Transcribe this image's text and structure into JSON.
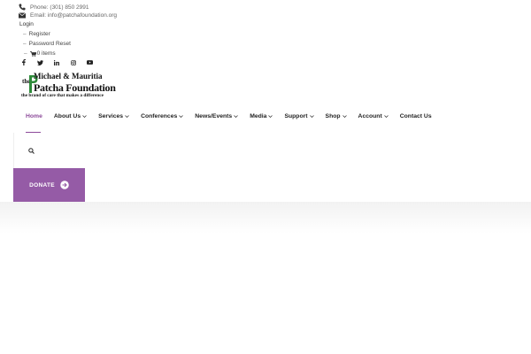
{
  "topbar": {
    "phone": "Phone: (301) 850 2991",
    "email": "Email: info@patchafoundation.org",
    "login": "Login",
    "register": "Register",
    "password_reset": "Password Reset",
    "cart": "0 items",
    "dash": "–",
    "social": [
      "facebook-icon",
      "twitter-icon",
      "linkedin-icon",
      "instagram-icon",
      "youtube-icon"
    ]
  },
  "logo": {
    "line1": "Michael & Mauritia",
    "line2": "Patcha Foundation",
    "the": "the",
    "tagline": "the brand of care that makes a difference"
  },
  "nav": {
    "items": [
      {
        "label": "Home",
        "dropdown": false,
        "active": true
      },
      {
        "label": "About Us",
        "dropdown": true
      },
      {
        "label": "Services",
        "dropdown": true
      },
      {
        "label": "Conferences",
        "dropdown": true
      },
      {
        "label": "News/Events",
        "dropdown": true
      },
      {
        "label": "Media",
        "dropdown": true
      },
      {
        "label": "Support",
        "dropdown": true
      },
      {
        "label": "Shop",
        "dropdown": true
      },
      {
        "label": "Account",
        "dropdown": true
      },
      {
        "label": "Contact Us",
        "dropdown": false
      }
    ]
  },
  "donate": {
    "label": "DONATE"
  },
  "colors": {
    "accent": "#955ba6",
    "active": "#8c4a9a",
    "logo_green": "#2e8b3a"
  }
}
